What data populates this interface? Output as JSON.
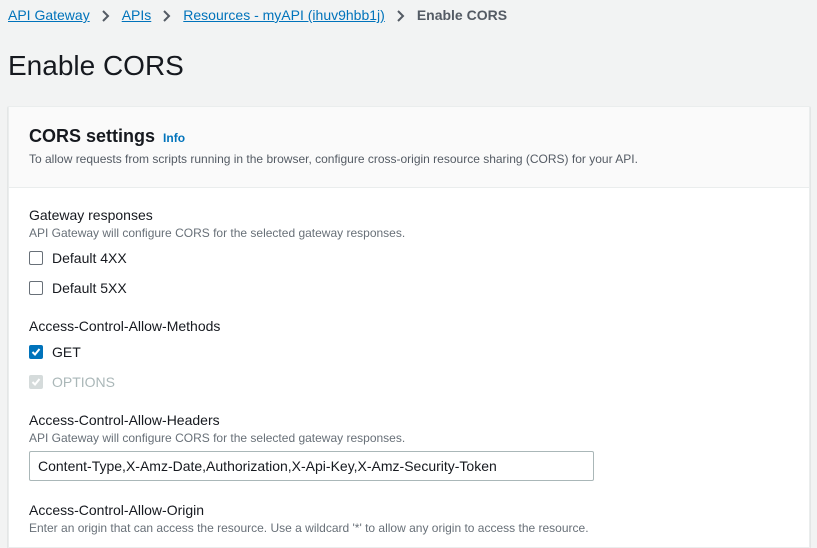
{
  "breadcrumb": {
    "items": [
      "API Gateway",
      "APIs",
      "Resources - myAPI (ihuv9hbb1j)"
    ],
    "current": "Enable CORS"
  },
  "page_title": "Enable CORS",
  "panel": {
    "title": "CORS settings",
    "info_label": "Info",
    "description": "To allow requests from scripts running in the browser, configure cross-origin resource sharing (CORS) for your API."
  },
  "gateway_responses": {
    "label": "Gateway responses",
    "hint": "API Gateway will configure CORS for the selected gateway responses.",
    "options": [
      {
        "label": "Default 4XX",
        "checked": false
      },
      {
        "label": "Default 5XX",
        "checked": false
      }
    ]
  },
  "allow_methods": {
    "label": "Access-Control-Allow-Methods",
    "options": [
      {
        "label": "GET",
        "checked": true,
        "disabled": false
      },
      {
        "label": "OPTIONS",
        "checked": true,
        "disabled": true
      }
    ]
  },
  "allow_headers": {
    "label": "Access-Control-Allow-Headers",
    "hint": "API Gateway will configure CORS for the selected gateway responses.",
    "value": "Content-Type,X-Amz-Date,Authorization,X-Api-Key,X-Amz-Security-Token"
  },
  "allow_origin": {
    "label": "Access-Control-Allow-Origin",
    "hint": "Enter an origin that can access the resource. Use a wildcard '*' to allow any origin to access the resource."
  },
  "colors": {
    "link": "#0073bb",
    "checked": "#0073bb",
    "disabled": "#d5dbdb",
    "background": "#f2f3f3"
  }
}
